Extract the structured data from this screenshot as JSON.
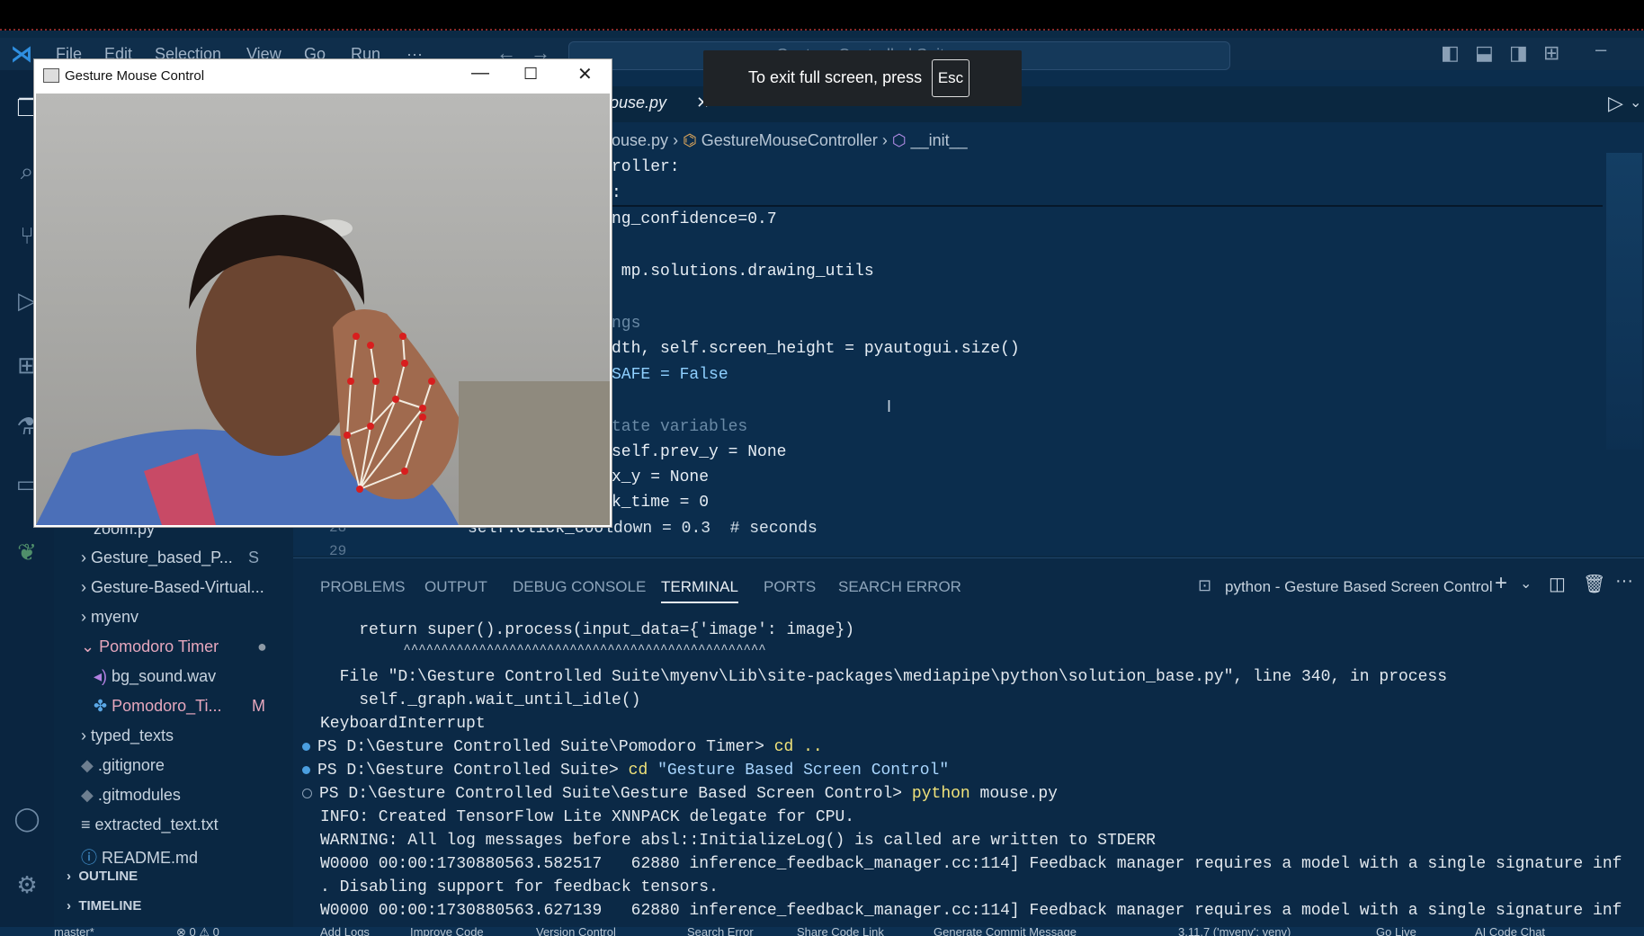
{
  "titlebar": {
    "menus": [
      "File",
      "Edit",
      "Selection",
      "View",
      "Go",
      "Run",
      "···"
    ],
    "search": "Gesture Controlled Suite"
  },
  "toast": {
    "message": "To exit full screen, press",
    "key": "Esc"
  },
  "camera_window": {
    "title": "Gesture Mouse Control",
    "min": "—",
    "max": "☐",
    "close": "✕"
  },
  "editor": {
    "tab": "ouse.py",
    "breadcrumb": {
      "file": "ouse.py",
      "class": "GestureMouseController",
      "method": "__init__"
    },
    "lines": [
      "roller:",
      ":",
      "ng_confidence=0.7",
      "",
      " mp.solutions.drawing_utils",
      "",
      "ngs",
      "dth, self.screen_height = pyautogui.size()",
      "SAFE = False",
      "",
      "tate variables",
      "self.prev_y = None",
      "x_y = None",
      "k_time = 0"
    ],
    "last_line": "self.click_cooldown = 0.3  # seconds",
    "gutter": [
      "28",
      "29"
    ]
  },
  "sidebar": {
    "items": [
      {
        "label": "zoom.py",
        "badge": ""
      },
      {
        "label": "Gesture_based_P...",
        "badge": "S"
      },
      {
        "label": "Gesture-Based-Virtual...",
        "badge": ""
      },
      {
        "label": "myenv",
        "badge": ""
      },
      {
        "label": "Pomodoro Timer",
        "badge": "●"
      },
      {
        "label": "bg_sound.wav",
        "badge": ""
      },
      {
        "label": "Pomodoro_Ti...",
        "badge": "M"
      },
      {
        "label": "typed_texts",
        "badge": ""
      },
      {
        "label": ".gitignore",
        "badge": ""
      },
      {
        "label": ".gitmodules",
        "badge": ""
      },
      {
        "label": "extracted_text.txt",
        "badge": ""
      },
      {
        "label": "README.md",
        "badge": ""
      }
    ],
    "outline": "OUTLINE",
    "timeline": "TIMELINE"
  },
  "panel": {
    "tabs": [
      "PROBLEMS",
      "OUTPUT",
      "DEBUG CONSOLE",
      "TERMINAL",
      "PORTS",
      "SEARCH ERROR"
    ],
    "terminal_name": "python - Gesture Based Screen Control",
    "lines": [
      "    return super().process(input_data={'image': image})",
      "           ^^^^^^^^^^^^^^^^^^^^^^^^^^^^^^^^^^^^^^^^^^^^^^^^",
      "  File \"D:\\Gesture Controlled Suite\\myenv\\Lib\\site-packages\\mediapipe\\python\\solution_base.py\", line 340, in process",
      "    self._graph.wait_until_idle()",
      "KeyboardInterrupt"
    ],
    "prompts": [
      {
        "path": "PS D:\\Gesture Controlled Suite\\Pomodoro Timer> ",
        "cmd": "cd ..",
        "arg": ""
      },
      {
        "path": "PS D:\\Gesture Controlled Suite> ",
        "cmd": "cd",
        "arg": " \"Gesture Based Screen Control\""
      },
      {
        "path": "PS D:\\Gesture Controlled Suite\\Gesture Based Screen Control> ",
        "cmd": "python",
        "arg": " mouse.py"
      }
    ],
    "output": [
      "INFO: Created TensorFlow Lite XNNPACK delegate for CPU.",
      "WARNING: All log messages before absl::InitializeLog() is called are written to STDERR",
      "W0000 00:00:1730880563.582517   62880 inference_feedback_manager.cc:114] Feedback manager requires a model with a single signature inf",
      ". Disabling support for feedback tensors.",
      "W0000 00:00:1730880563.627139   62880 inference_feedback_manager.cc:114] Feedback manager requires a model with a single signature inf"
    ]
  },
  "statusbar": [
    "master*",
    "⊗ 0 ⚠ 0",
    "Add Logs",
    "Improve Code",
    "Version Control",
    "Search Error",
    "Share Code Link",
    "Generate Commit Message",
    "3.11.7 ('myenv': venv)",
    "Go Live",
    "AI Code Chat"
  ]
}
